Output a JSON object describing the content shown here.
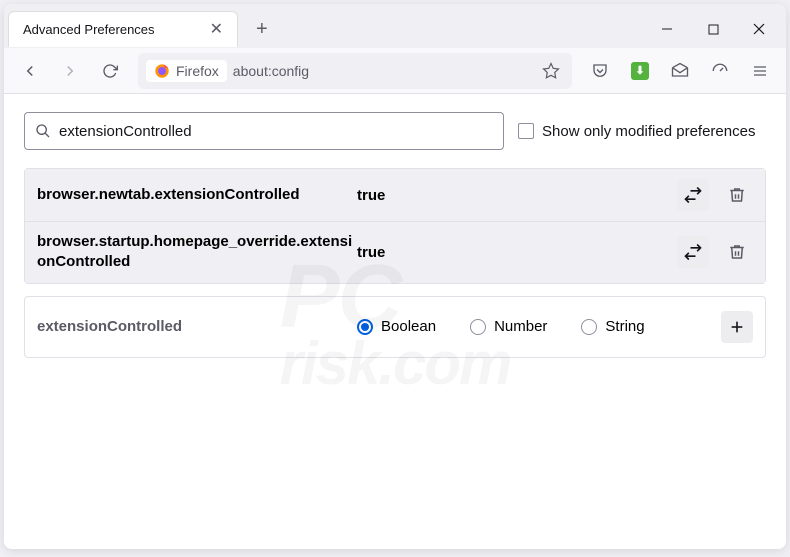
{
  "window": {
    "tab_title": "Advanced Preferences"
  },
  "toolbar": {
    "identity_label": "Firefox",
    "url": "about:config"
  },
  "config": {
    "search_value": "extensionControlled",
    "modified_only_label": "Show only modified preferences",
    "modified_only_checked": false,
    "prefs": [
      {
        "name": "browser.newtab.extensionControlled",
        "value": "true",
        "modified": true
      },
      {
        "name": "browser.startup.homepage_override.extensionControlled",
        "value": "true",
        "modified": true
      }
    ],
    "new_pref": {
      "name": "extensionControlled",
      "types": [
        "Boolean",
        "Number",
        "String"
      ],
      "selected": "Boolean"
    }
  }
}
